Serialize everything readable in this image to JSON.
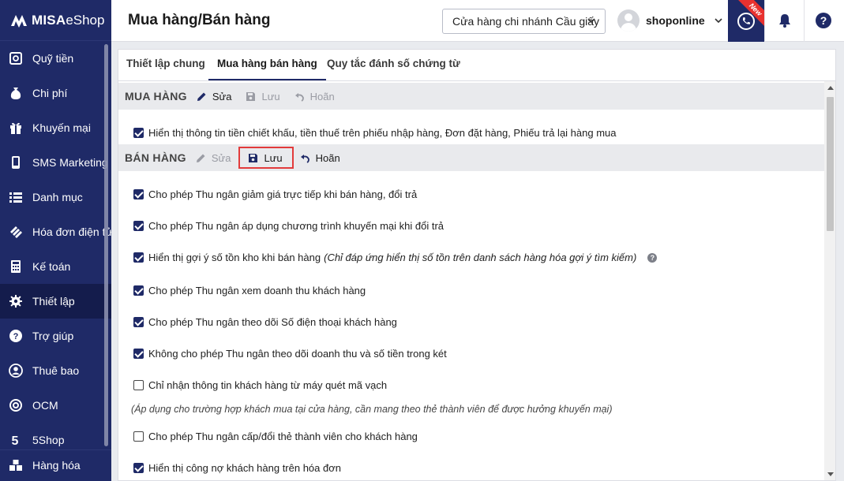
{
  "brand": {
    "part1": "MISA",
    "part2": "eShop"
  },
  "sidebar": {
    "items": [
      {
        "label": "Quỹ tiền",
        "icon": "safe-icon"
      },
      {
        "label": "Chi phí",
        "icon": "money-bag-icon"
      },
      {
        "label": "Khuyến mại",
        "icon": "gift-icon"
      },
      {
        "label": "SMS Marketing",
        "icon": "mobile-icon"
      },
      {
        "label": "Danh mục",
        "icon": "list-icon"
      },
      {
        "label": "Hóa đơn điện tử",
        "icon": "invoice-icon"
      },
      {
        "label": "Kế toán",
        "icon": "calculator-icon"
      },
      {
        "label": "Thiết lập",
        "icon": "gear-icon",
        "active": true
      },
      {
        "label": "Trợ giúp",
        "icon": "help-icon"
      },
      {
        "label": "Thuê bao",
        "icon": "user-icon"
      },
      {
        "label": "OCM",
        "icon": "ocm-icon"
      },
      {
        "label": "5Shop",
        "icon": "5shop-icon"
      }
    ],
    "bottom_item": {
      "label": "Hàng hóa",
      "icon": "boxes-icon"
    }
  },
  "header": {
    "title": "Mua hàng/Bán hàng",
    "branch_select": "Cửa hàng chi nhánh Cầu giấy",
    "username": "shoponline",
    "new_badge": "New"
  },
  "tabs": [
    {
      "label": "Thiết lập chung"
    },
    {
      "label": "Mua hàng bán hàng",
      "active": true
    },
    {
      "label": "Quy tắc đánh số chứng từ"
    }
  ],
  "purchase": {
    "title": "MUA HÀNG",
    "edit": "Sửa",
    "save": "Lưu",
    "undo": "Hoãn",
    "options": [
      {
        "label": "Hiển thị thông tin tiền chiết khấu, tiền thuế trên phiếu nhập hàng, Đơn đặt hàng, Phiếu trả lại hàng mua",
        "checked": true
      }
    ]
  },
  "sales": {
    "title": "BÁN HÀNG",
    "edit": "Sửa",
    "save": "Lưu",
    "undo": "Hoãn",
    "options": [
      {
        "label": "Cho phép Thu ngân giảm giá trực tiếp khi bán hàng, đổi trả",
        "checked": true
      },
      {
        "label": "Cho phép Thu ngân áp dụng chương trình khuyến mại khi đổi trả",
        "checked": true
      },
      {
        "label": "Hiển thị gợi ý số tồn kho khi bán hàng",
        "note": "(Chỉ đáp ứng hiển thị số tồn trên danh sách hàng hóa gợi ý tìm kiếm)",
        "checked": true
      },
      {
        "label": "Cho phép Thu ngân xem doanh thu khách hàng",
        "checked": true
      },
      {
        "label": "Cho phép Thu ngân theo dõi Số điện thoại khách hàng",
        "checked": true
      },
      {
        "label": "Không cho phép Thu ngân theo dõi doanh thu và số tiền trong két",
        "checked": true
      },
      {
        "label": "Chỉ nhận thông tin khách hàng từ máy quét mã vạch",
        "checked": false
      },
      {
        "label": "Cho phép Thu ngân cấp/đổi thẻ thành viên cho khách hàng",
        "checked": false
      },
      {
        "label": "Hiển thị công nợ khách hàng trên hóa đơn",
        "checked": true
      }
    ],
    "hint": "(Áp dụng cho trường hợp khách mua tại cửa hàng, cần mang theo thẻ thành viên để được hưởng khuyến mại)"
  }
}
